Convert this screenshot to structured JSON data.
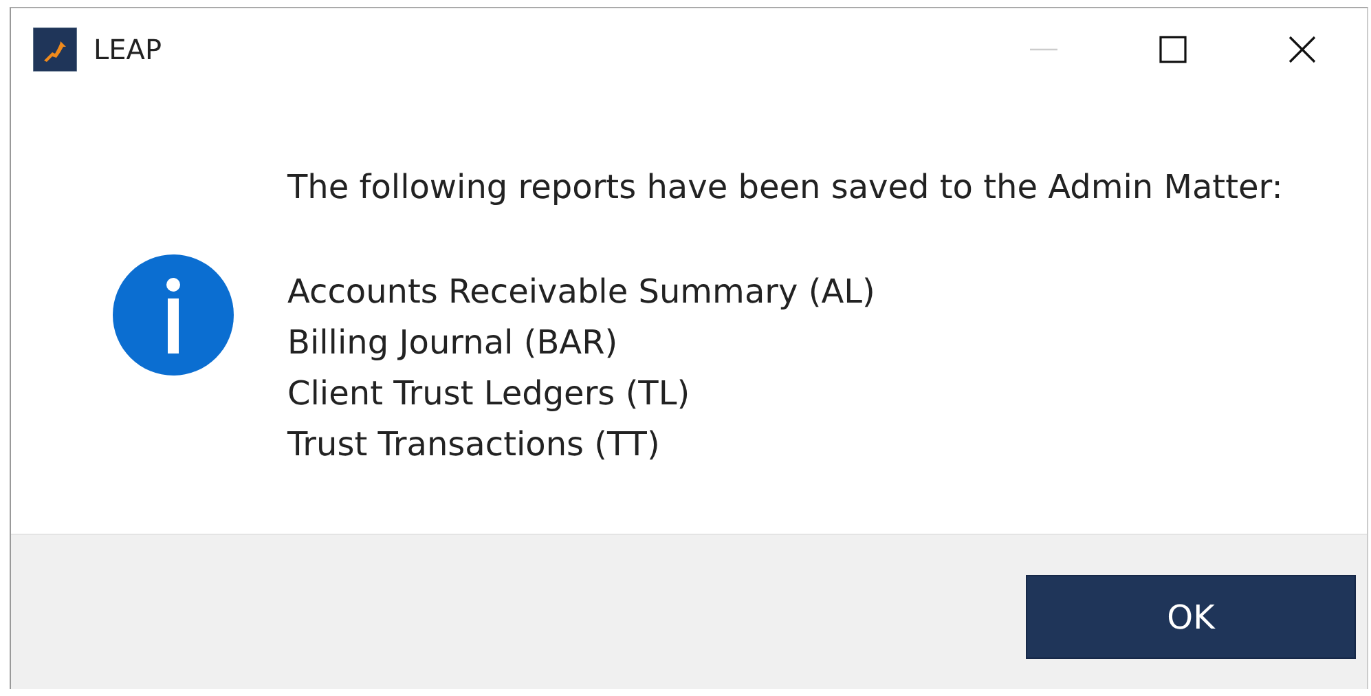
{
  "window": {
    "title": "LEAP",
    "controls": [
      {
        "kind": "minimize",
        "disabled": true
      },
      {
        "kind": "maximize",
        "disabled": false
      },
      {
        "kind": "close",
        "disabled": false
      }
    ]
  },
  "message": {
    "heading": "The following reports have been saved to the Admin Matter:",
    "reports": [
      "Accounts Receivable Summary (AL)",
      "Billing Journal (BAR)",
      "Client Trust Ledgers (TL)",
      "Trust Transactions (TT)"
    ]
  },
  "buttons": [
    "OK"
  ]
}
